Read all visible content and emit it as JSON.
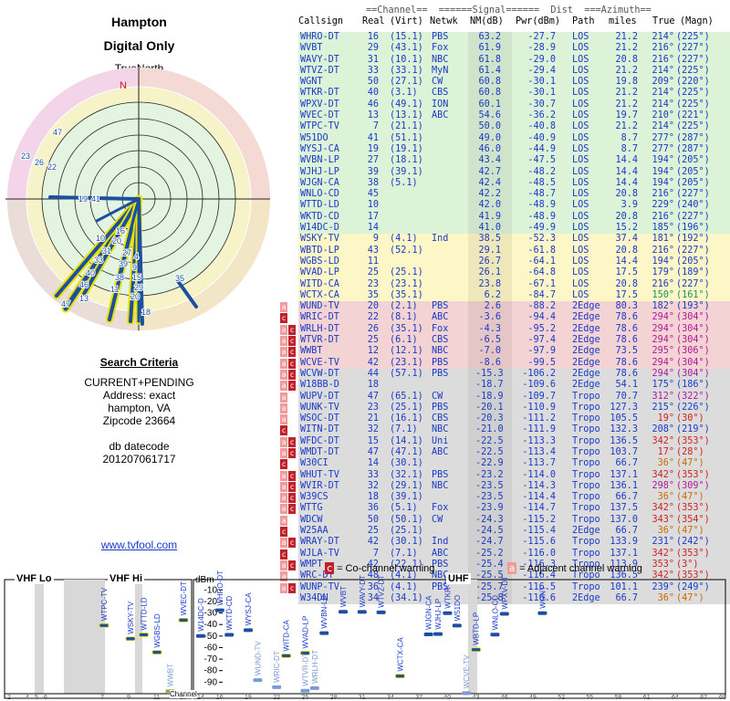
{
  "header": {
    "title1": "Hampton",
    "title2": "Digital Only",
    "north_label": "TrueNorth",
    "n_marker": "N"
  },
  "criteria": {
    "heading": "Search Criteria",
    "mode": "CURRENT+PENDING",
    "address": "Address: exact",
    "city": "hampton, VA",
    "zip": "Zipcode 23664",
    "db_label": "db datecode",
    "db_value": "201207061717"
  },
  "link": "www.tvfool.com",
  "table_header": {
    "line1": "==Channel==  ======Signal======  Dist  ===Azimuth==",
    "c1": "Callsign",
    "c2": "Real",
    "c3": "(Virt)",
    "c4": "Netwk",
    "c5": "NM(dB)",
    "c6": "Pwr(dBm)",
    "c7": "Path",
    "c8": "miles",
    "c9": "True",
    "c10": "(Magn)"
  },
  "rows": [
    {
      "cs": "WHRO-DT",
      "real": "16",
      "virt": "(15.1)",
      "net": "PBS",
      "nm": "63.2",
      "pwr": "-27.7",
      "path": "LOS",
      "dist": "21.2",
      "tru": "214°",
      "mag": "(225°)",
      "band": "green",
      "warn": ""
    },
    {
      "cs": "WVBT",
      "real": "29",
      "virt": "(43.1)",
      "net": "Fox",
      "nm": "61.9",
      "pwr": "-28.9",
      "path": "LOS",
      "dist": "21.2",
      "tru": "216°",
      "mag": "(227°)",
      "band": "green",
      "warn": ""
    },
    {
      "cs": "WAVY-DT",
      "real": "31",
      "virt": "(10.1)",
      "net": "NBC",
      "nm": "61.8",
      "pwr": "-29.0",
      "path": "LOS",
      "dist": "20.8",
      "tru": "216°",
      "mag": "(227°)",
      "band": "green",
      "warn": ""
    },
    {
      "cs": "WTVZ-DT",
      "real": "33",
      "virt": "(33.1)",
      "net": "MyN",
      "nm": "61.4",
      "pwr": "-29.4",
      "path": "LOS",
      "dist": "21.2",
      "tru": "214°",
      "mag": "(225°)",
      "band": "green",
      "warn": ""
    },
    {
      "cs": "WGNT",
      "real": "50",
      "virt": "(27.1)",
      "net": "CW",
      "nm": "60.8",
      "pwr": "-30.1",
      "path": "LOS",
      "dist": "19.8",
      "tru": "209°",
      "mag": "(220°)",
      "band": "green",
      "warn": ""
    },
    {
      "cs": "WTKR-DT",
      "real": "40",
      "virt": "(3.1)",
      "net": "CBS",
      "nm": "60.8",
      "pwr": "-30.1",
      "path": "LOS",
      "dist": "21.2",
      "tru": "214°",
      "mag": "(225°)",
      "band": "green",
      "warn": ""
    },
    {
      "cs": "WPXV-DT",
      "real": "46",
      "virt": "(49.1)",
      "net": "ION",
      "nm": "60.1",
      "pwr": "-30.7",
      "path": "LOS",
      "dist": "21.2",
      "tru": "214°",
      "mag": "(225°)",
      "band": "green",
      "warn": ""
    },
    {
      "cs": "WVEC-DT",
      "real": "13",
      "virt": "(13.1)",
      "net": "ABC",
      "nm": "54.6",
      "pwr": "-36.2",
      "path": "LOS",
      "dist": "19.7",
      "tru": "210°",
      "mag": "(221°)",
      "band": "green",
      "warn": ""
    },
    {
      "cs": "WTPC-TV",
      "real": "7",
      "virt": "(21.1)",
      "net": "",
      "nm": "50.0",
      "pwr": "-40.8",
      "path": "LOS",
      "dist": "21.2",
      "tru": "214°",
      "mag": "(225°)",
      "band": "green",
      "warn": ""
    },
    {
      "cs": "W51DO",
      "real": "41",
      "virt": "(51.1)",
      "net": "",
      "nm": "49.0",
      "pwr": "-40.9",
      "path": "LOS",
      "dist": "8.7",
      "tru": "277°",
      "mag": "(287°)",
      "band": "green",
      "warn": ""
    },
    {
      "cs": "WYSJ-CA",
      "real": "19",
      "virt": "(19.1)",
      "net": "",
      "nm": "46.0",
      "pwr": "-44.9",
      "path": "LOS",
      "dist": "8.7",
      "tru": "277°",
      "mag": "(287°)",
      "band": "green",
      "warn": ""
    },
    {
      "cs": "WVBN-LP",
      "real": "27",
      "virt": "(18.1)",
      "net": "",
      "nm": "43.4",
      "pwr": "-47.5",
      "path": "LOS",
      "dist": "14.4",
      "tru": "194°",
      "mag": "(205°)",
      "band": "green",
      "warn": ""
    },
    {
      "cs": "WJHJ-LP",
      "real": "39",
      "virt": "(39.1)",
      "net": "",
      "nm": "42.7",
      "pwr": "-48.2",
      "path": "LOS",
      "dist": "14.4",
      "tru": "194°",
      "mag": "(205°)",
      "band": "green",
      "warn": ""
    },
    {
      "cs": "WJGN-CA",
      "real": "38",
      "virt": "(5.1)",
      "net": "",
      "nm": "42.4",
      "pwr": "-48.5",
      "path": "LOS",
      "dist": "14.4",
      "tru": "194°",
      "mag": "(205°)",
      "band": "green",
      "warn": ""
    },
    {
      "cs": "WNLO-CD",
      "real": "45",
      "virt": "",
      "net": "",
      "nm": "42.2",
      "pwr": "-48.7",
      "path": "LOS",
      "dist": "20.8",
      "tru": "216°",
      "mag": "(227°)",
      "band": "green",
      "warn": ""
    },
    {
      "cs": "WTTD-LD",
      "real": "10",
      "virt": "",
      "net": "",
      "nm": "42.0",
      "pwr": "-48.9",
      "path": "LOS",
      "dist": "3.9",
      "tru": "229°",
      "mag": "(240°)",
      "band": "green",
      "warn": ""
    },
    {
      "cs": "WKTD-CD",
      "real": "17",
      "virt": "",
      "net": "",
      "nm": "41.9",
      "pwr": "-48.9",
      "path": "LOS",
      "dist": "20.8",
      "tru": "216°",
      "mag": "(227°)",
      "band": "green",
      "warn": ""
    },
    {
      "cs": "W14DC-D",
      "real": "14",
      "virt": "",
      "net": "",
      "nm": "41.0",
      "pwr": "-49.9",
      "path": "LOS",
      "dist": "15.2",
      "tru": "185°",
      "mag": "(196°)",
      "band": "green",
      "warn": ""
    },
    {
      "cs": "WSKY-TV",
      "real": "9",
      "virt": "(4.1)",
      "net": "Ind",
      "nm": "38.5",
      "pwr": "-52.3",
      "path": "LOS",
      "dist": "37.4",
      "tru": "181°",
      "mag": "(192°)",
      "band": "yellow",
      "warn": ""
    },
    {
      "cs": "WBTD-LP",
      "real": "43",
      "virt": "(52.1)",
      "net": "",
      "nm": "29.1",
      "pwr": "-61.8",
      "path": "LOS",
      "dist": "20.8",
      "tru": "216°",
      "mag": "(227°)",
      "band": "yellow",
      "warn": ""
    },
    {
      "cs": "WGBS-LD",
      "real": "11",
      "virt": "",
      "net": "",
      "nm": "26.7",
      "pwr": "-64.1",
      "path": "LOS",
      "dist": "14.4",
      "tru": "194°",
      "mag": "(205°)",
      "band": "yellow",
      "warn": ""
    },
    {
      "cs": "WVAD-LP",
      "real": "25",
      "virt": "(25.1)",
      "net": "",
      "nm": "26.1",
      "pwr": "-64.8",
      "path": "LOS",
      "dist": "17.5",
      "tru": "179°",
      "mag": "(189°)",
      "band": "yellow",
      "warn": ""
    },
    {
      "cs": "WITD-CA",
      "real": "23",
      "virt": "(23.1)",
      "net": "",
      "nm": "23.8",
      "pwr": "-67.1",
      "path": "LOS",
      "dist": "20.8",
      "tru": "216°",
      "mag": "(227°)",
      "band": "yellow",
      "warn": ""
    },
    {
      "cs": "WCTX-CA",
      "real": "35",
      "virt": "(35.1)",
      "net": "",
      "nm": "6.2",
      "pwr": "-84.7",
      "path": "LOS",
      "dist": "17.5",
      "tru": "150°",
      "mag": "(161°)",
      "band": "yellow",
      "warn": ""
    },
    {
      "cs": "WUND-TV",
      "real": "20",
      "virt": "(2.1)",
      "net": "PBS",
      "nm": "2.6",
      "pwr": "-88.2",
      "path": "2Edge",
      "dist": "80.3",
      "tru": "182°",
      "mag": "(193°)",
      "band": "pink",
      "warn": "a"
    },
    {
      "cs": "WRIC-DT",
      "real": "22",
      "virt": "(8.1)",
      "net": "ABC",
      "nm": "-3.6",
      "pwr": "-94.4",
      "path": "2Edge",
      "dist": "78.6",
      "tru": "294°",
      "mag": "(304°)",
      "band": "pink",
      "warn": "c"
    },
    {
      "cs": "WRLH-DT",
      "real": "26",
      "virt": "(35.1)",
      "net": "Fox",
      "nm": "-4.3",
      "pwr": "-95.2",
      "path": "2Edge",
      "dist": "78.6",
      "tru": "294°",
      "mag": "(304°)",
      "band": "pink",
      "warn": "ac"
    },
    {
      "cs": "WTVR-DT",
      "real": "25",
      "virt": "(6.1)",
      "net": "CBS",
      "nm": "-6.5",
      "pwr": "-97.4",
      "path": "2Edge",
      "dist": "78.6",
      "tru": "294°",
      "mag": "(304°)",
      "band": "pink",
      "warn": "ac"
    },
    {
      "cs": "WWBT",
      "real": "12",
      "virt": "(12.1)",
      "net": "NBC",
      "nm": "-7.0",
      "pwr": "-97.9",
      "path": "2Edge",
      "dist": "73.5",
      "tru": "295°",
      "mag": "(306°)",
      "band": "pink",
      "warn": "ac"
    },
    {
      "cs": "WCVE-TV",
      "real": "42",
      "virt": "(23.1)",
      "net": "PBS",
      "nm": "-8.6",
      "pwr": "-99.5",
      "path": "2Edge",
      "dist": "78.6",
      "tru": "294°",
      "mag": "(304°)",
      "band": "pink",
      "warn": "ac"
    },
    {
      "cs": "WCVW-DT",
      "real": "44",
      "virt": "(57.1)",
      "net": "PBS",
      "nm": "-15.3",
      "pwr": "-106.2",
      "path": "2Edge",
      "dist": "78.6",
      "tru": "294°",
      "mag": "(304°)",
      "band": "gray",
      "warn": "ac"
    },
    {
      "cs": "W18BB-D",
      "real": "18",
      "virt": "",
      "net": "",
      "nm": "-18.7",
      "pwr": "-109.6",
      "path": "2Edge",
      "dist": "54.1",
      "tru": "175°",
      "mag": "(186°)",
      "band": "gray",
      "warn": "ac"
    },
    {
      "cs": "WUPV-DT",
      "real": "47",
      "virt": "(65.1)",
      "net": "CW",
      "nm": "-18.9",
      "pwr": "-109.7",
      "path": "Tropo",
      "dist": "70.7",
      "tru": "312°",
      "mag": "(322°)",
      "band": "gray",
      "warn": "a"
    },
    {
      "cs": "WUNK-TV",
      "real": "23",
      "virt": "(25.1)",
      "net": "PBS",
      "nm": "-20.1",
      "pwr": "-110.9",
      "path": "Tropo",
      "dist": "127.3",
      "tru": "215°",
      "mag": "(226°)",
      "band": "gray",
      "warn": "a"
    },
    {
      "cs": "WSOC-DT",
      "real": "21",
      "virt": "(16.1)",
      "net": "CBS",
      "nm": "-20.3",
      "pwr": "-111.2",
      "path": "Tropo",
      "dist": "105.5",
      "tru": "19°",
      "mag": "(30°)",
      "band": "gray",
      "warn": "a"
    },
    {
      "cs": "WITN-DT",
      "real": "32",
      "virt": "(7.1)",
      "net": "NBC",
      "nm": "-21.0",
      "pwr": "-111.9",
      "path": "Tropo",
      "dist": "132.3",
      "tru": "208°",
      "mag": "(219°)",
      "band": "gray",
      "warn": "c"
    },
    {
      "cs": "WFDC-DT",
      "real": "15",
      "virt": "(14.1)",
      "net": "Uni",
      "nm": "-22.5",
      "pwr": "-113.3",
      "path": "Tropo",
      "dist": "136.5",
      "tru": "342°",
      "mag": "(353°)",
      "band": "gray",
      "warn": "ac"
    },
    {
      "cs": "WMDT-DT",
      "real": "47",
      "virt": "(47.1)",
      "net": "ABC",
      "nm": "-22.5",
      "pwr": "-113.4",
      "path": "Tropo",
      "dist": "103.7",
      "tru": "17°",
      "mag": "(28°)",
      "band": "gray",
      "warn": "ac"
    },
    {
      "cs": "W30CI",
      "real": "14",
      "virt": "(30.1)",
      "net": "",
      "nm": "-22.9",
      "pwr": "-113.7",
      "path": "Tropo",
      "dist": "66.7",
      "tru": "36°",
      "mag": "(47°)",
      "band": "gray",
      "warn": "c"
    },
    {
      "cs": "WHUT-TV",
      "real": "33",
      "virt": "(32.1)",
      "net": "PBS",
      "nm": "-23.2",
      "pwr": "-114.0",
      "path": "Tropo",
      "dist": "137.1",
      "tru": "342°",
      "mag": "(353°)",
      "band": "gray",
      "warn": "ac"
    },
    {
      "cs": "WVIR-DT",
      "real": "32",
      "virt": "(29.1)",
      "net": "NBC",
      "nm": "-23.5",
      "pwr": "-114.3",
      "path": "Tropo",
      "dist": "136.1",
      "tru": "298°",
      "mag": "(309°)",
      "band": "gray",
      "warn": "ac"
    },
    {
      "cs": "W39CS",
      "real": "18",
      "virt": "(39.1)",
      "net": "",
      "nm": "-23.5",
      "pwr": "-114.4",
      "path": "Tropo",
      "dist": "66.7",
      "tru": "36°",
      "mag": "(47°)",
      "band": "gray",
      "warn": "ac"
    },
    {
      "cs": "WTTG",
      "real": "36",
      "virt": "(5.1)",
      "net": "Fox",
      "nm": "-23.9",
      "pwr": "-114.7",
      "path": "Tropo",
      "dist": "137.5",
      "tru": "342°",
      "mag": "(353°)",
      "band": "gray",
      "warn": "ac"
    },
    {
      "cs": "WDCW",
      "real": "50",
      "virt": "(50.1)",
      "net": "CW",
      "nm": "-24.3",
      "pwr": "-115.2",
      "path": "Tropo",
      "dist": "137.0",
      "tru": "343°",
      "mag": "(354°)",
      "band": "gray",
      "warn": "a"
    },
    {
      "cs": "W25AA",
      "real": "25",
      "virt": "(25.1)",
      "net": "",
      "nm": "-24.5",
      "pwr": "-115.4",
      "path": "2Edge",
      "dist": "66.7",
      "tru": "36°",
      "mag": "(47°)",
      "band": "gray",
      "warn": "c"
    },
    {
      "cs": "WRAY-DT",
      "real": "42",
      "virt": "(30.1)",
      "net": "Ind",
      "nm": "-24.7",
      "pwr": "-115.6",
      "path": "Tropo",
      "dist": "133.9",
      "tru": "231°",
      "mag": "(242°)",
      "band": "gray",
      "warn": "ac"
    },
    {
      "cs": "WJLA-TV",
      "real": "7",
      "virt": "(7.1)",
      "net": "ABC",
      "nm": "-25.2",
      "pwr": "-116.0",
      "path": "Tropo",
      "dist": "137.1",
      "tru": "342°",
      "mag": "(353°)",
      "band": "gray",
      "warn": "c"
    },
    {
      "cs": "WMPT",
      "real": "42",
      "virt": "(22.1)",
      "net": "PBS",
      "nm": "-25.4",
      "pwr": "-116.3",
      "path": "Tropo",
      "dist": "113.9",
      "tru": "353°",
      "mag": "(3°)",
      "band": "gray",
      "warn": "ac"
    },
    {
      "cs": "WRC-DT",
      "real": "48",
      "virt": "(4.1)",
      "net": "NBC",
      "nm": "-25.5",
      "pwr": "-116.4",
      "path": "Tropo",
      "dist": "136.5",
      "tru": "342°",
      "mag": "(353°)",
      "band": "gray",
      "warn": "a"
    },
    {
      "cs": "WUNP-TV",
      "real": "36",
      "virt": "(4.1)",
      "net": "PBS",
      "nm": "-25.7",
      "pwr": "-116.5",
      "path": "Tropo",
      "dist": "101.1",
      "tru": "239°",
      "mag": "(249°)",
      "band": "gray",
      "warn": "ac"
    },
    {
      "cs": "W34DN",
      "real": "34",
      "virt": "(34.1)",
      "net": "",
      "nm": "-25.8",
      "pwr": "-116.6",
      "path": "2Edge",
      "dist": "66.7",
      "tru": "36°",
      "mag": "(47°)",
      "band": "gray",
      "warn": ""
    }
  ],
  "legend": {
    "cochannel": "= Co-channel warning",
    "adjacent": "= Adjacent channel warning",
    "c_marker": "c",
    "a_marker": "a"
  },
  "bands": {
    "vhf_lo": "VHF Lo",
    "vhf_hi": "VHF Hi",
    "uhf": "UHF",
    "dbm": "dBm",
    "channel_label": "Channel"
  },
  "dbm_ticks": [
    "-10",
    "-20",
    "-30",
    "-40",
    "-50",
    "-60",
    "-70",
    "-80",
    "-90"
  ],
  "colors": {
    "green": "#dcf3d8",
    "yellow": "#fdf6c6",
    "pink": "#f3d3d3",
    "gray": "#dcdcdc",
    "blue": "#1a3ac8",
    "bar": "#1c4fa0",
    "warn_red": "#c0202a",
    "warn_pink": "#f09a9a"
  }
}
